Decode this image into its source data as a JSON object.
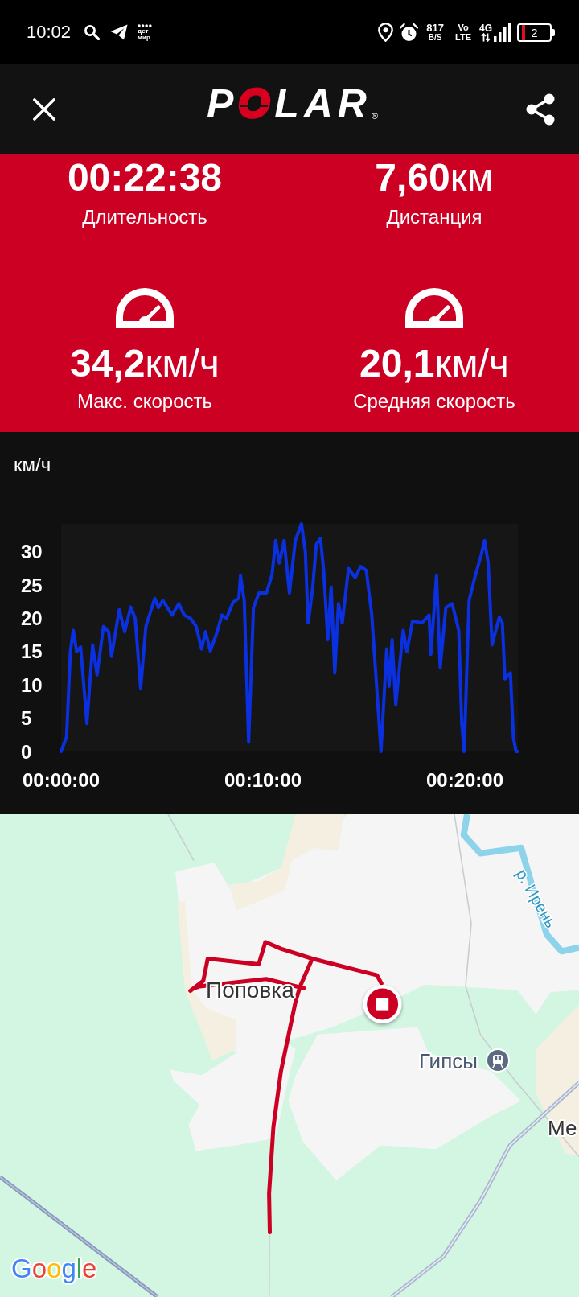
{
  "status_bar": {
    "time": "10:02",
    "app_badge": "дет мир",
    "net_speed": "817",
    "net_speed_unit": "B/S",
    "volte": "Vo LTE",
    "network": "4G",
    "battery": "2"
  },
  "header": {
    "brand": "POLAR",
    "brand_mark": "®"
  },
  "summary": [
    {
      "kind": "plain",
      "value": "00:22:38",
      "label": "Длительность"
    },
    {
      "kind": "plain",
      "value": "7,60",
      "unit": "км",
      "label": "Дистанция"
    },
    {
      "kind": "speed",
      "value": "34,2",
      "unit": "км/ч",
      "label": "Макс. скорость"
    },
    {
      "kind": "speed",
      "value": "20,1",
      "unit": "км/ч",
      "label": "Средняя скорость"
    }
  ],
  "chart": {
    "chart_data": {
      "type": "line",
      "ylabel": "км/ч",
      "x": [
        0,
        0.27,
        0.46,
        0.6,
        0.77,
        0.97,
        1.28,
        1.56,
        1.78,
        2.1,
        2.35,
        2.5,
        2.88,
        3.15,
        3.45,
        3.67,
        3.94,
        4.2,
        4.64,
        4.82,
        5.04,
        5.5,
        5.83,
        6.1,
        6.41,
        6.69,
        6.96,
        7.15,
        7.39,
        7.7,
        7.97,
        8.19,
        8.52,
        8.8,
        8.89,
        9.07,
        9.29,
        9.53,
        9.8,
        10.17,
        10.45,
        10.63,
        10.81,
        11.05,
        11.31,
        11.6,
        11.91,
        12.1,
        12.24,
        12.46,
        12.64,
        12.85,
        13.01,
        13.21,
        13.38,
        13.56,
        13.74,
        13.93,
        14.24,
        14.57,
        14.84,
        15.12,
        15.39,
        15.67,
        15.85,
        16.13,
        16.25,
        16.4,
        16.58,
        16.95,
        17.13,
        17.41,
        17.87,
        18.23,
        18.32,
        18.6,
        18.78,
        19.06,
        19.37,
        19.7,
        19.85,
        19.97,
        20.21,
        20.52,
        20.8,
        20.98,
        21.16,
        21.35,
        21.71,
        21.86,
        21.99,
        22.26,
        22.41,
        22.54,
        22.63
      ],
      "series": [
        {
          "color": "#0a30e0",
          "values": [
            0,
            2.2,
            15,
            18.2,
            15,
            15.7,
            4.2,
            16,
            11.5,
            18.8,
            18,
            14.3,
            21.3,
            18,
            21.7,
            20,
            9.5,
            18.8,
            23,
            21.6,
            22.7,
            20.5,
            22.2,
            20.5,
            20,
            18.8,
            15.4,
            18,
            15.1,
            17.7,
            20.5,
            20,
            22.4,
            23,
            26.4,
            22.7,
            1.4,
            21.6,
            23.8,
            23.8,
            26.6,
            31.7,
            28.3,
            31.7,
            23.8,
            31.7,
            34.2,
            30,
            19.3,
            24.4,
            31.1,
            32,
            27.2,
            16.8,
            24.7,
            11.8,
            22.2,
            19.3,
            27.5,
            26.1,
            27.8,
            27.2,
            20.5,
            8.1,
            0,
            15.4,
            9.8,
            16.8,
            7,
            18.2,
            15,
            19.6,
            19.3,
            20.5,
            14.6,
            26.4,
            12.6,
            21.6,
            22.2,
            18.2,
            4.2,
            0,
            22.7,
            26.4,
            29.4,
            31.7,
            28.3,
            16,
            20.2,
            19.3,
            10.9,
            11.8,
            2,
            0,
            0
          ]
        }
      ],
      "xlim": [
        0,
        22.63
      ],
      "ylim": [
        0,
        34.2
      ],
      "xticks": [
        {
          "value": 0,
          "label": "00:00:00"
        },
        {
          "value": 10,
          "label": "00:10:00"
        },
        {
          "value": 20,
          "label": "00:20:00"
        }
      ],
      "yticks": [
        0,
        5,
        10,
        15,
        20,
        25,
        30
      ]
    }
  },
  "map": {
    "places": [
      {
        "kind": "locality",
        "label": "Поповка"
      },
      {
        "kind": "station",
        "label": "Гипсы"
      },
      {
        "kind": "locality",
        "label": "Ме"
      }
    ],
    "river_label": "р. Ирень",
    "attribution": "Google"
  }
}
